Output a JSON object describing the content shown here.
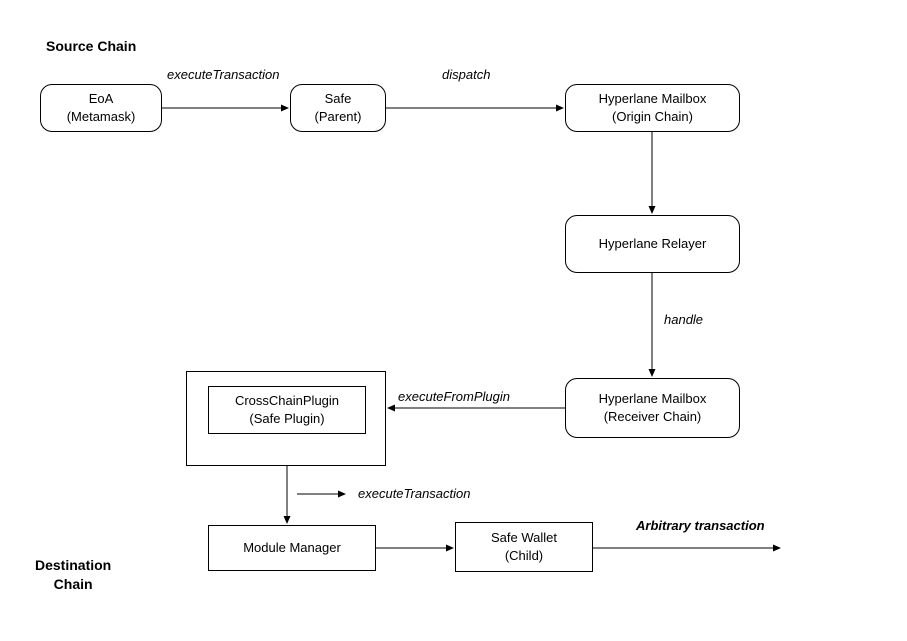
{
  "sections": {
    "source": "Source Chain",
    "destination_line1": "Destination",
    "destination_line2": "Chain"
  },
  "nodes": {
    "eoa_line1": "EoA",
    "eoa_line2": "(Metamask)",
    "safe_parent_line1": "Safe",
    "safe_parent_line2": "(Parent)",
    "mailbox_origin_line1": "Hyperlane Mailbox",
    "mailbox_origin_line2": "(Origin Chain)",
    "relayer": "Hyperlane Relayer",
    "mailbox_receiver_line1": "Hyperlane Mailbox",
    "mailbox_receiver_line2": "(Receiver Chain)",
    "cross_chain_plugin_line1": "CrossChainPlugin",
    "cross_chain_plugin_line2": "(Safe Plugin)",
    "module_manager": "Module Manager",
    "safe_wallet_line1": "Safe Wallet",
    "safe_wallet_line2": "(Child)"
  },
  "edges": {
    "execute_transaction_1": "executeTransaction",
    "dispatch": "dispatch",
    "handle": "handle",
    "execute_from_plugin": "executeFromPlugin",
    "execute_transaction_2": "executeTransaction",
    "arbitrary": "Arbitrary transaction"
  }
}
